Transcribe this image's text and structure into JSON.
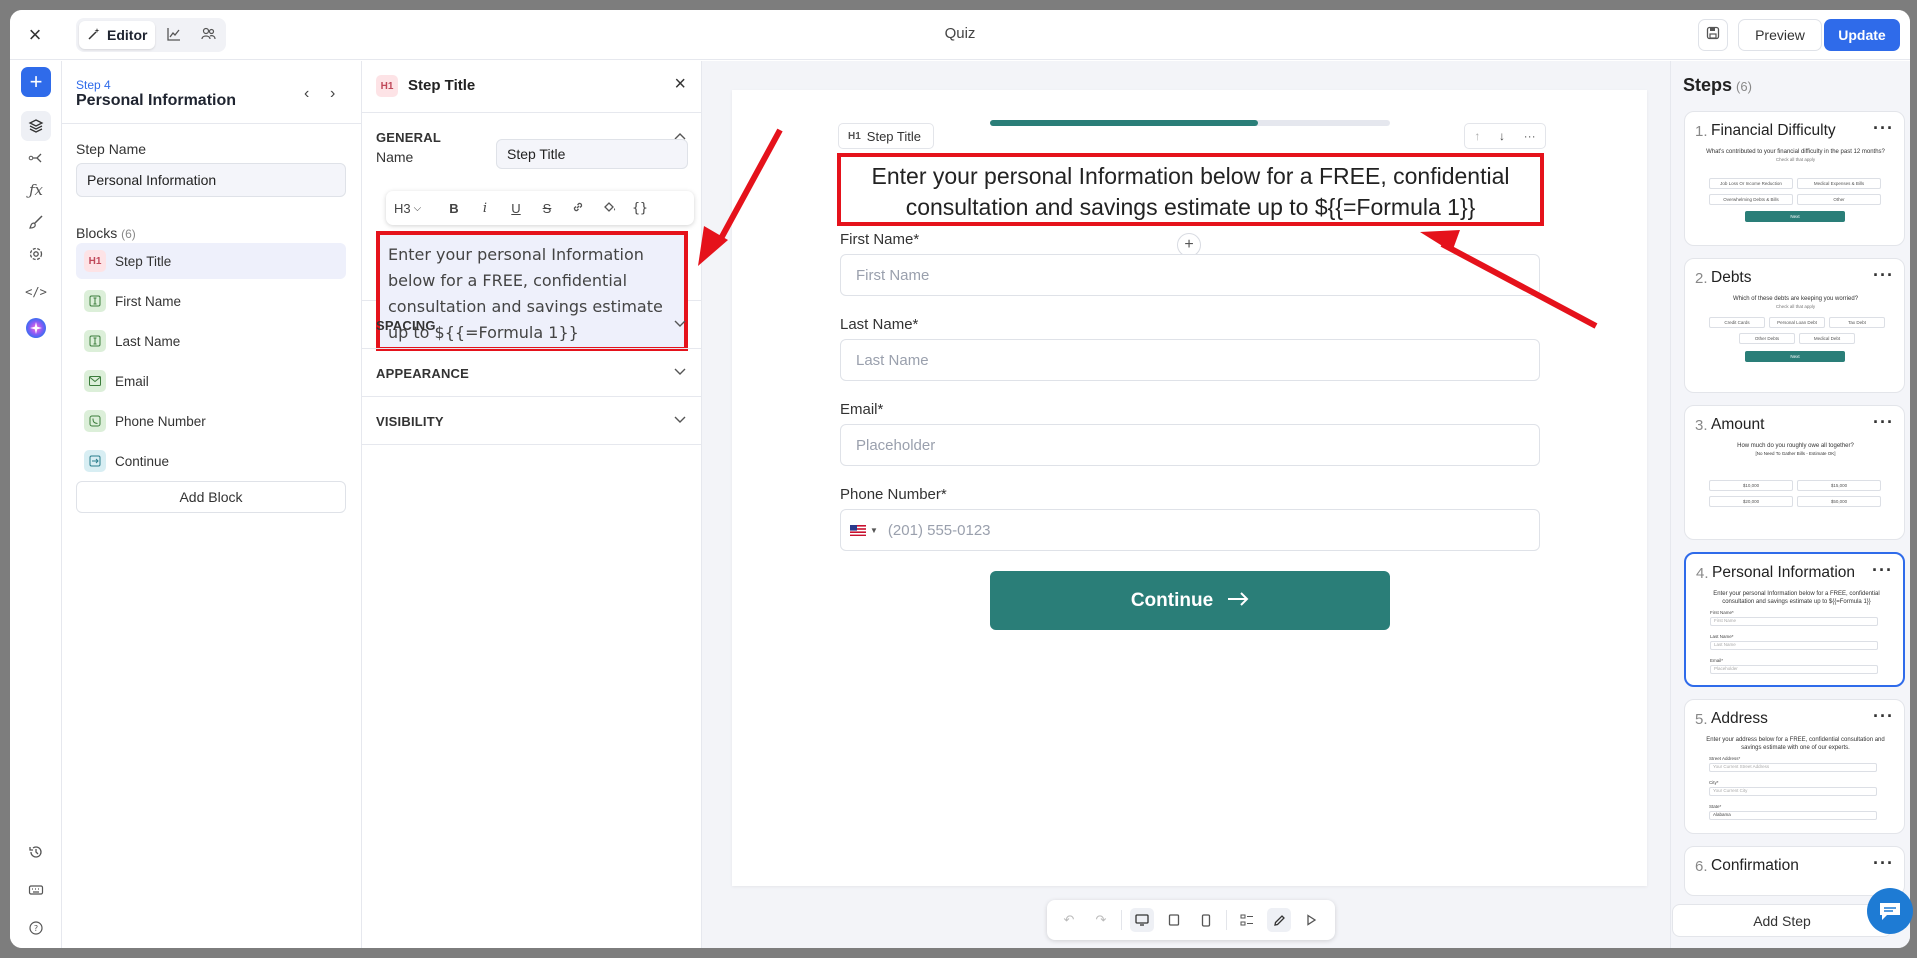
{
  "topbar": {
    "title": "Quiz",
    "editor_label": "Editor",
    "preview_label": "Preview",
    "update_label": "Update"
  },
  "sidebar": {
    "step_label": "Step 4",
    "step_title": "Personal Information",
    "step_name_label": "Step Name",
    "step_name_value": "Personal Information",
    "blocks_label": "Blocks",
    "blocks_count": "(6)",
    "blocks": [
      {
        "icon": "H1",
        "label": "Step Title"
      },
      {
        "icon": "I",
        "label": "First Name"
      },
      {
        "icon": "I",
        "label": "Last Name"
      },
      {
        "icon": "mail",
        "label": "Email"
      },
      {
        "icon": "phone",
        "label": "Phone Number"
      },
      {
        "icon": "arrow",
        "label": "Continue"
      }
    ],
    "add_block_label": "Add Block"
  },
  "props": {
    "header_badge": "H1",
    "header_title": "Step Title",
    "general_label": "GENERAL",
    "name_label": "Name",
    "name_value": "Step Title",
    "heading_level": "H3",
    "rich_text": "Enter your personal Information below for a FREE, confidential consultation and savings estimate up to ${{=Formula 1}}",
    "spacing_label": "SPACING",
    "appearance_label": "APPEARANCE",
    "visibility_label": "VISIBILITY"
  },
  "canvas": {
    "block_tag": "Step Title",
    "block_tag_badge": "H1",
    "progress": 0.67,
    "title": "Enter your personal Information below for a FREE, confidential consultation and savings estimate up to ${{=Formula 1}}",
    "fields": [
      {
        "label": "First Name*",
        "placeholder": "First Name"
      },
      {
        "label": "Last Name*",
        "placeholder": "Last Name"
      },
      {
        "label": "Email*",
        "placeholder": "Placeholder"
      },
      {
        "label": "Phone Number*",
        "placeholder": "(201) 555-0123"
      }
    ],
    "continue_label": "Continue"
  },
  "steps_panel": {
    "title": "Steps",
    "count": "(6)",
    "steps": [
      {
        "num": "1.",
        "title": "Financial Difficulty",
        "question": "What's contributed to your financial difficulty in the past 12 months?",
        "hint": "Check all that apply",
        "options": [
          "Job Loss Or Income Reduction",
          "Medical Expenses & Bills",
          "Overwhelming Debts & Bills",
          "Other"
        ],
        "button": "Next"
      },
      {
        "num": "2.",
        "title": "Debts",
        "question": "Which of these debts are keeping you worried?",
        "hint": "Check all that apply",
        "options": [
          "Credit Cards",
          "Personal Loan Debt",
          "Tax Debt",
          "Other Debts",
          "Medical Debt"
        ],
        "button": "Next"
      },
      {
        "num": "3.",
        "title": "Amount",
        "question": "How much do you roughly owe all together?",
        "hint": "[No Need To Gather Bills - Estimate OK]",
        "options": [
          "$10,000",
          "$15,000",
          "$20,000",
          "$50,000"
        ],
        "button": ""
      },
      {
        "num": "4.",
        "title": "Personal Information",
        "question": "Enter your personal Information below for a FREE, confidential consultation and savings estimate up to ${{=Formula 1}}",
        "fields": [
          "First Name*",
          "Last Name*",
          "Email*"
        ],
        "placeholders": [
          "First Name",
          "Last Name",
          "Placeholder"
        ]
      },
      {
        "num": "5.",
        "title": "Address",
        "question": "Enter your address below for a FREE, confidential consultation and savings estimate with one of our experts.",
        "fields": [
          "Street Address*",
          "City*",
          "State*"
        ],
        "placeholders": [
          "Your Current Street Address",
          "Your Current City",
          "Alabama"
        ]
      },
      {
        "num": "6.",
        "title": "Confirmation"
      }
    ],
    "add_step_label": "Add Step"
  },
  "colors": {
    "accent_blue": "#2f6bea",
    "primary_teal": "#2a7e78",
    "annotation_red": "#e5121b"
  }
}
